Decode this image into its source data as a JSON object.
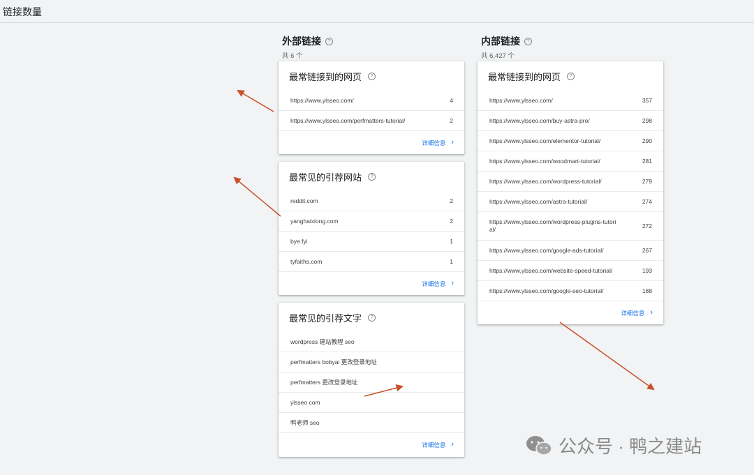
{
  "page_title": "链接数量",
  "external": {
    "title": "外部链接",
    "subtitle": "共 6 个",
    "top_linked_pages": {
      "title": "最常链接到的网页",
      "rows": [
        {
          "label": "https://www.ylsseo.com/",
          "value": "4"
        },
        {
          "label": "https://www.ylsseo.com/perfmatters-tutorial/",
          "value": "2"
        }
      ],
      "details": "详细信息"
    },
    "top_linking_sites": {
      "title": "最常见的引荐网站",
      "rows": [
        {
          "label": "reddit.com",
          "value": "2"
        },
        {
          "label": "yanghaixiong.com",
          "value": "2"
        },
        {
          "label": "bye.fyi",
          "value": "1"
        },
        {
          "label": "tyfaiths.com",
          "value": "1"
        }
      ],
      "details": "详细信息"
    },
    "top_linking_text": {
      "title": "最常见的引荐文字",
      "rows": [
        {
          "label": "wordpress 建站教程 seo"
        },
        {
          "label": "perfmatters bobyai 更改登录地址"
        },
        {
          "label": "perfmatters 更改登录地址"
        },
        {
          "label": "ylsseo com"
        },
        {
          "label": "鸭老师 seo"
        }
      ],
      "details": "详细信息"
    }
  },
  "internal": {
    "title": "内部链接",
    "subtitle": "共 6,427 个",
    "top_linked_pages": {
      "title": "最常链接到的网页",
      "rows": [
        {
          "label": "https://www.ylsseo.com/",
          "value": "357"
        },
        {
          "label": "https://www.ylsseo.com/buy-astra-pro/",
          "value": "298"
        },
        {
          "label": "https://www.ylsseo.com/elementor-tutorial/",
          "value": "290"
        },
        {
          "label": "https://www.ylsseo.com/woodmart-tutorial/",
          "value": "281"
        },
        {
          "label": "https://www.ylsseo.com/wordpress-tutorial/",
          "value": "279"
        },
        {
          "label": "https://www.ylsseo.com/astra-tutorial/",
          "value": "274"
        },
        {
          "label": "https://www.ylsseo.com/wordpress-plugins-tutorial/",
          "value": "272"
        },
        {
          "label": "https://www.ylsseo.com/google-ads-tutorial/",
          "value": "267"
        },
        {
          "label": "https://www.ylsseo.com/website-speed-tutorial/",
          "value": "193"
        },
        {
          "label": "https://www.ylsseo.com/google-seo-tutorial/",
          "value": "188"
        }
      ],
      "details": "详细信息"
    }
  },
  "watermark": {
    "account": "公众号 · 鸭之建站"
  },
  "colors": {
    "accent": "#1a73e8",
    "annotation_arrow": "#c8502a",
    "background": "#f1f3f4"
  },
  "icons": {
    "help": "help-circle-icon",
    "chevron": "chevron-right-icon",
    "watermark": "wechat-icon"
  }
}
